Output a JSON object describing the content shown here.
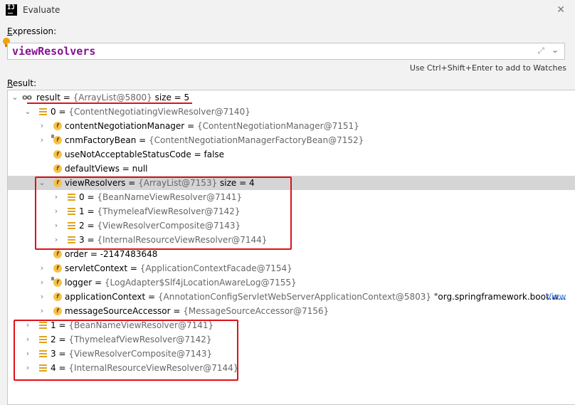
{
  "window": {
    "title": "Evaluate",
    "close_glyph": "✕"
  },
  "expression": {
    "label_first": "E",
    "label_rest": "xpression:",
    "value": "viewResolvers",
    "hint": "Use Ctrl+Shift+Enter to add to Watches"
  },
  "result": {
    "label_first": "R",
    "label_rest": "esult:",
    "root": {
      "name": "result",
      "eq": " = ",
      "ref": "{ArrayList@5800}",
      "extra": "  size = 5"
    },
    "item0": {
      "name": "0",
      "eq": " = ",
      "ref": "{ContentNegotiatingViewResolver@7140}"
    },
    "fields": [
      {
        "name": "contentNegotiationManager",
        "ref": "{ContentNegotiationManager@7151}"
      },
      {
        "name": "cnmFactoryBean",
        "ref": "{ContentNegotiationManagerFactoryBean@7152}"
      },
      {
        "name": "useNotAcceptableStatusCode",
        "val": "false"
      },
      {
        "name": "defaultViews",
        "val": "null"
      }
    ],
    "viewResolvers": {
      "name": "viewResolvers",
      "ref": "{ArrayList@7153}",
      "extra": "  size = 4"
    },
    "vr_items": [
      {
        "idx": "0",
        "ref": "{BeanNameViewResolver@7141}"
      },
      {
        "idx": "1",
        "ref": "{ThymeleafViewResolver@7142}"
      },
      {
        "idx": "2",
        "ref": "{ViewResolverComposite@7143}"
      },
      {
        "idx": "3",
        "ref": "{InternalResourceViewResolver@7144}"
      }
    ],
    "more_fields": [
      {
        "name": "order",
        "val": "-2147483648"
      },
      {
        "name": "servletContext",
        "ref": "{ApplicationContextFacade@7154}"
      },
      {
        "name": "logger",
        "ref": "{LogAdapter$Slf4jLocationAwareLog@7155}"
      },
      {
        "name": "applicationContext",
        "ref": "{AnnotationConfigServletWebServerApplicationContext@5803}",
        "str": " \"org.springframework.boot.w...",
        "link": "View"
      },
      {
        "name": "messageSourceAccessor",
        "ref": "{MessageSourceAccessor@7156}"
      }
    ],
    "top_items": [
      {
        "idx": "1",
        "ref": "{BeanNameViewResolver@7141}"
      },
      {
        "idx": "2",
        "ref": "{ThymeleafViewResolver@7142}"
      },
      {
        "idx": "3",
        "ref": "{ViewResolverComposite@7143}"
      },
      {
        "idx": "4",
        "ref": "{InternalResourceViewResolver@7144}"
      }
    ]
  },
  "icons": {
    "field": "field-icon",
    "list": "list-element-icon",
    "watch": "watch-result-icon",
    "chevron_right": "›",
    "chevron_down": "⌄"
  },
  "colors": {
    "highlight": "#e0101a",
    "selection": "#d5d5d5",
    "expression": "#871094"
  }
}
